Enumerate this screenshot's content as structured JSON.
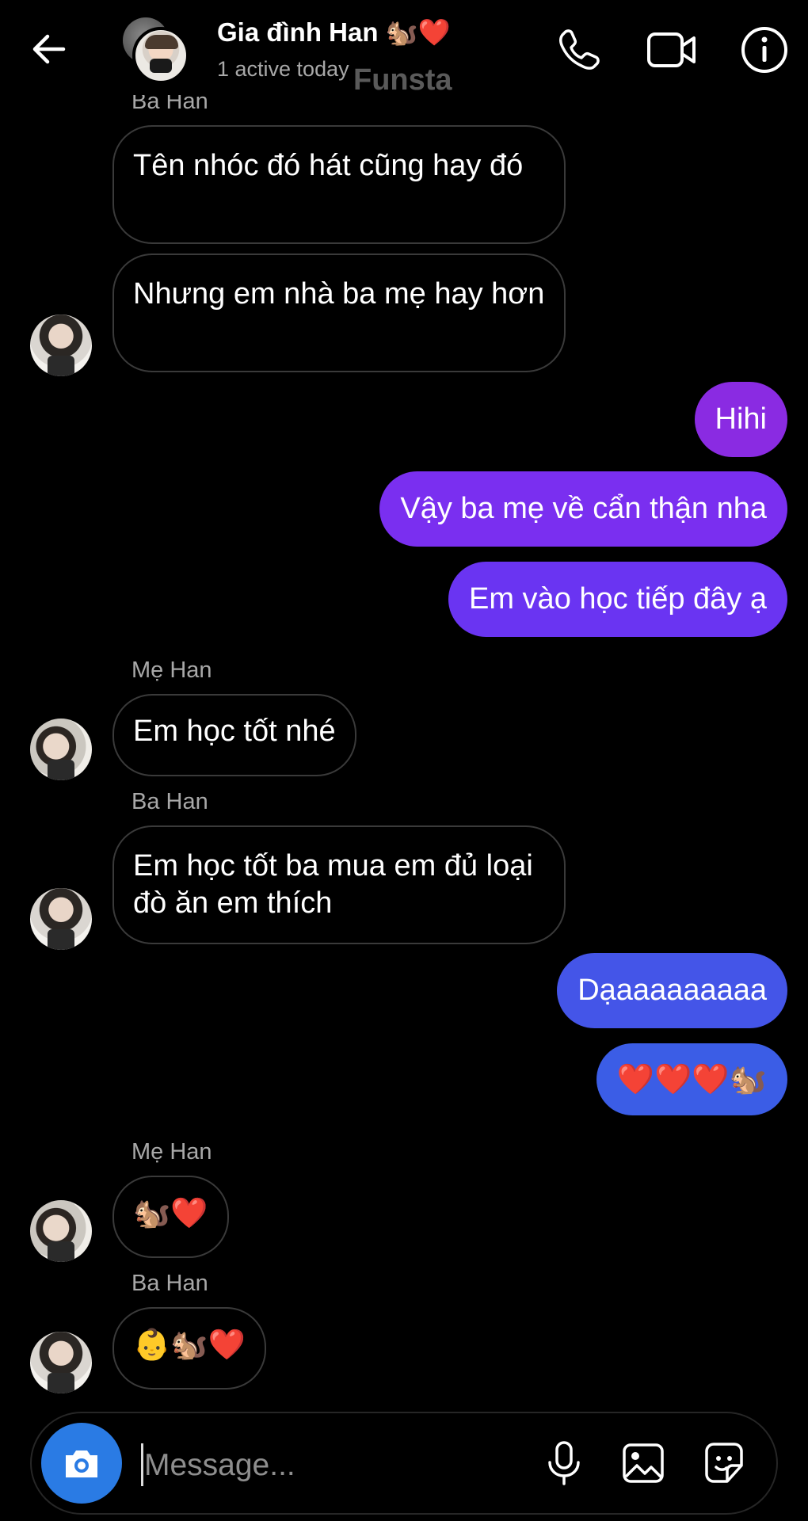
{
  "header": {
    "title": "Gia đình Han 🐿️❤️",
    "status": "1 active today",
    "watermark": "Funsta"
  },
  "messages": [
    {
      "from": "Ba Han",
      "text": "Tên nhóc đó hát cũng hay đó"
    },
    {
      "from": "Ba Han",
      "text": "Nhưng em nhà ba mẹ hay hơn"
    },
    {
      "from": "me",
      "text": "Hihi"
    },
    {
      "from": "me",
      "text": "Vậy ba mẹ về cẩn thận nha"
    },
    {
      "from": "me",
      "text": "Em vào học tiếp đây ạ"
    },
    {
      "from": "Mẹ Han",
      "text": "Em học tốt nhé"
    },
    {
      "from": "Ba Han",
      "text": "Em học tốt ba mua em đủ loại đò ăn em thích"
    },
    {
      "from": "me",
      "text": "Dạaaaaaaaaa"
    },
    {
      "from": "me",
      "text": "❤️❤️❤️🐿️"
    },
    {
      "from": "Mẹ Han",
      "text": "🐿️❤️"
    },
    {
      "from": "Ba Han",
      "text": "👶🐿️❤️"
    }
  ],
  "labels": {
    "ba_top": "Ba Han",
    "me_1": "Mẹ Han",
    "ba_1": "Ba Han",
    "me_2": "Mẹ Han",
    "ba_2": "Ba Han"
  },
  "composer": {
    "placeholder": "Message..."
  },
  "colors": {
    "outgoing_top": "#8a2be2",
    "outgoing_mid": "#6c32f0",
    "outgoing_bottom": "#3b5de6",
    "camera_button": "#2a7be4"
  }
}
